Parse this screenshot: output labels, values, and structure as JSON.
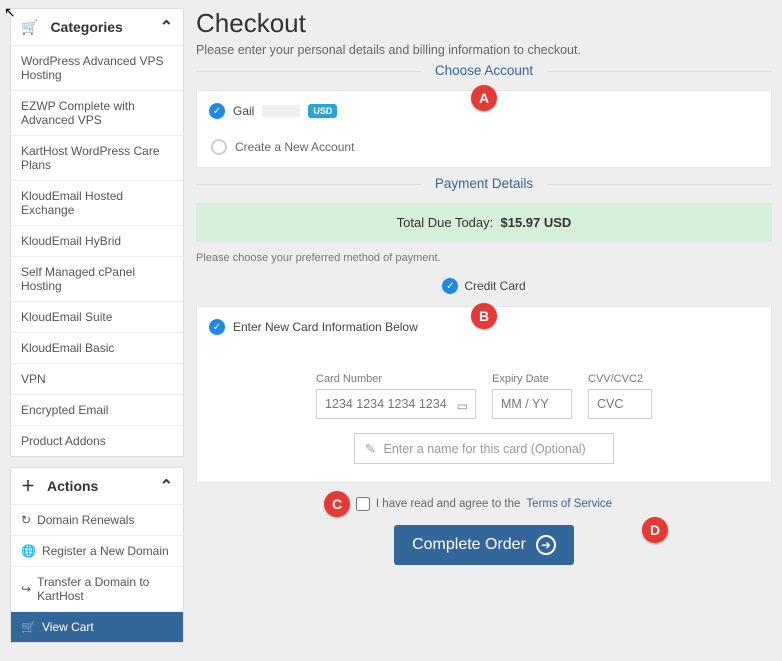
{
  "page": {
    "title": "Checkout",
    "subtitle": "Please enter your personal details and billing information to checkout."
  },
  "sidebar": {
    "categoriesHeader": "Categories",
    "categories": [
      "WordPress Advanced VPS Hosting",
      "EZWP Complete with Advanced VPS",
      "KartHost WordPress Care Plans",
      "KloudEmail Hosted Exchange",
      "KloudEmail HyBrid",
      "Self Managed cPanel Hosting",
      "KloudEmail Suite",
      "KloudEmail Basic",
      "VPN",
      "Encrypted Email",
      "Product Addons"
    ],
    "actionsHeader": "Actions",
    "actions": [
      {
        "label": "Domain Renewals",
        "icon": "refresh-icon"
      },
      {
        "label": "Register a New Domain",
        "icon": "globe-icon"
      },
      {
        "label": "Transfer a Domain to KartHost",
        "icon": "share-icon"
      },
      {
        "label": "View Cart",
        "icon": "cart-icon",
        "active": true
      }
    ]
  },
  "account": {
    "sectionTitle": "Choose Account",
    "selectedName": "Gail",
    "currencyBadge": "USD",
    "newAccountLabel": "Create a New Account"
  },
  "payment": {
    "sectionTitle": "Payment Details",
    "totalPrefix": "Total Due Today:",
    "totalValue": "$15.97 USD",
    "prefNote": "Please choose your preferred method of payment.",
    "creditCardLabel": "Credit Card",
    "enterNewCardLabel": "Enter New Card Information Below",
    "cardNumberLabel": "Card Number",
    "cardNumberPlaceholder": "1234 1234 1234 1234",
    "expiryLabel": "Expiry Date",
    "expiryPlaceholder": "MM / YY",
    "cvcLabel": "CVV/CVC2",
    "cvcPlaceholder": "CVC",
    "optionalNamePlaceholder": "Enter a name for this card (Optional)",
    "termsPrefix": "I have read and agree to the",
    "termsLink": "Terms of Service",
    "completeBtn": "Complete Order"
  },
  "markers": {
    "a": "A",
    "b": "B",
    "c": "C",
    "d": "D"
  }
}
